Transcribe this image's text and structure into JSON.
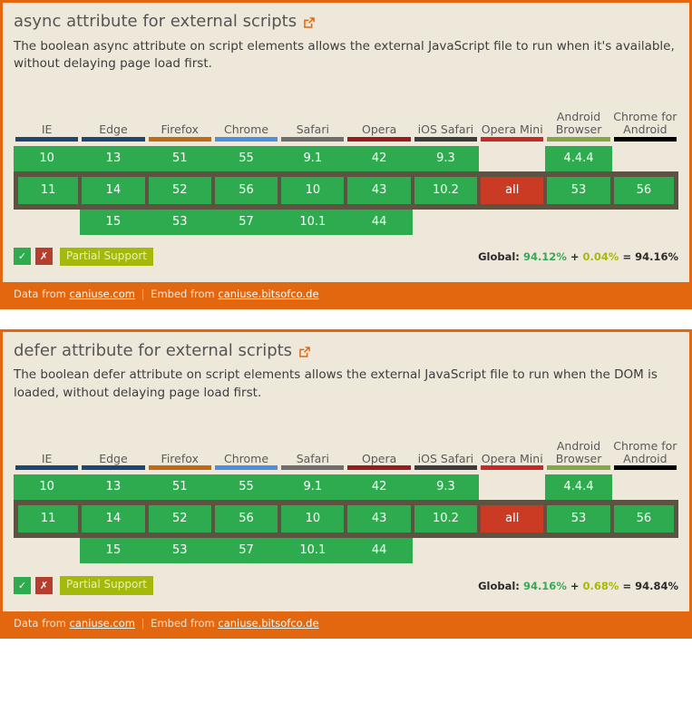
{
  "panels": [
    {
      "title": "async attribute for external scripts",
      "title_link_icon": "external-link-icon",
      "description": "The boolean async attribute on script elements allows the external JavaScript file to run when it's available, without delaying page load first.",
      "browsers": [
        {
          "name": "IE",
          "color": "#1d4674"
        },
        {
          "name": "Edge",
          "color": "#1d4674"
        },
        {
          "name": "Firefox",
          "color": "#bf6a14"
        },
        {
          "name": "Chrome",
          "color": "#4d90e0"
        },
        {
          "name": "Safari",
          "color": "#6e6e6e"
        },
        {
          "name": "Opera",
          "color": "#961d1d"
        },
        {
          "name": "iOS Safari",
          "color": "#3c3c3c"
        },
        {
          "name": "Opera Mini",
          "color": "#c32b2b"
        },
        {
          "name": "Android Browser",
          "color": "#82a845"
        },
        {
          "name": "Chrome for Android",
          "color": "#000000"
        }
      ],
      "rows": [
        {
          "kind": "previous",
          "cells": [
            {
              "label": "10",
              "support": "y"
            },
            {
              "label": "13",
              "support": "y"
            },
            {
              "label": "51",
              "support": "y"
            },
            {
              "label": "55",
              "support": "y"
            },
            {
              "label": "9.1",
              "support": "y"
            },
            {
              "label": "42",
              "support": "y"
            },
            {
              "label": "9.3",
              "support": "y"
            },
            {
              "label": "",
              "support": "empty"
            },
            {
              "label": "4.4.4",
              "support": "y"
            },
            {
              "label": "",
              "support": "empty"
            }
          ]
        },
        {
          "kind": "current",
          "cells": [
            {
              "label": "11",
              "support": "y"
            },
            {
              "label": "14",
              "support": "y"
            },
            {
              "label": "52",
              "support": "y"
            },
            {
              "label": "56",
              "support": "y"
            },
            {
              "label": "10",
              "support": "y"
            },
            {
              "label": "43",
              "support": "y"
            },
            {
              "label": "10.2",
              "support": "y"
            },
            {
              "label": "all",
              "support": "n"
            },
            {
              "label": "53",
              "support": "y"
            },
            {
              "label": "56",
              "support": "y"
            }
          ]
        },
        {
          "kind": "next",
          "cells": [
            {
              "label": "",
              "support": "empty"
            },
            {
              "label": "15",
              "support": "y"
            },
            {
              "label": "53",
              "support": "y"
            },
            {
              "label": "57",
              "support": "y"
            },
            {
              "label": "10.1",
              "support": "y"
            },
            {
              "label": "44",
              "support": "y"
            },
            {
              "label": "",
              "support": "empty"
            },
            {
              "label": "",
              "support": "empty"
            },
            {
              "label": "",
              "support": "empty"
            },
            {
              "label": "",
              "support": "empty"
            }
          ]
        }
      ],
      "legend": {
        "supported_icon": "check-icon",
        "supported_glyph": "✓",
        "unsupported_icon": "cross-icon",
        "unsupported_glyph": "✗",
        "partial_label": "Partial Support"
      },
      "global": {
        "label": "Global:",
        "full": "94.12%",
        "plus": "+",
        "partial": "0.04%",
        "equals": "=",
        "total": "94.16%"
      },
      "footer": {
        "data_from_label": "Data from",
        "data_link": "caniuse.com",
        "separator": "|",
        "embed_from_label": "Embed from",
        "embed_link": "caniuse.bitsofco.de"
      }
    },
    {
      "title": "defer attribute for external scripts",
      "title_link_icon": "external-link-icon",
      "description": "The boolean defer attribute on script elements allows the external JavaScript file to run when the DOM is loaded, without delaying page load first.",
      "browsers": [
        {
          "name": "IE",
          "color": "#1d4674"
        },
        {
          "name": "Edge",
          "color": "#1d4674"
        },
        {
          "name": "Firefox",
          "color": "#bf6a14"
        },
        {
          "name": "Chrome",
          "color": "#4d90e0"
        },
        {
          "name": "Safari",
          "color": "#6e6e6e"
        },
        {
          "name": "Opera",
          "color": "#961d1d"
        },
        {
          "name": "iOS Safari",
          "color": "#3c3c3c"
        },
        {
          "name": "Opera Mini",
          "color": "#c32b2b"
        },
        {
          "name": "Android Browser",
          "color": "#82a845"
        },
        {
          "name": "Chrome for Android",
          "color": "#000000"
        }
      ],
      "rows": [
        {
          "kind": "previous",
          "cells": [
            {
              "label": "10",
              "support": "y"
            },
            {
              "label": "13",
              "support": "y"
            },
            {
              "label": "51",
              "support": "y"
            },
            {
              "label": "55",
              "support": "y"
            },
            {
              "label": "9.1",
              "support": "y"
            },
            {
              "label": "42",
              "support": "y"
            },
            {
              "label": "9.3",
              "support": "y"
            },
            {
              "label": "",
              "support": "empty"
            },
            {
              "label": "4.4.4",
              "support": "y"
            },
            {
              "label": "",
              "support": "empty"
            }
          ]
        },
        {
          "kind": "current",
          "cells": [
            {
              "label": "11",
              "support": "y"
            },
            {
              "label": "14",
              "support": "y"
            },
            {
              "label": "52",
              "support": "y"
            },
            {
              "label": "56",
              "support": "y"
            },
            {
              "label": "10",
              "support": "y"
            },
            {
              "label": "43",
              "support": "y"
            },
            {
              "label": "10.2",
              "support": "y"
            },
            {
              "label": "all",
              "support": "n"
            },
            {
              "label": "53",
              "support": "y"
            },
            {
              "label": "56",
              "support": "y"
            }
          ]
        },
        {
          "kind": "next",
          "cells": [
            {
              "label": "",
              "support": "empty"
            },
            {
              "label": "15",
              "support": "y"
            },
            {
              "label": "53",
              "support": "y"
            },
            {
              "label": "57",
              "support": "y"
            },
            {
              "label": "10.1",
              "support": "y"
            },
            {
              "label": "44",
              "support": "y"
            },
            {
              "label": "",
              "support": "empty"
            },
            {
              "label": "",
              "support": "empty"
            },
            {
              "label": "",
              "support": "empty"
            },
            {
              "label": "",
              "support": "empty"
            }
          ]
        }
      ],
      "legend": {
        "supported_icon": "check-icon",
        "supported_glyph": "✓",
        "unsupported_icon": "cross-icon",
        "unsupported_glyph": "✗",
        "partial_label": "Partial Support"
      },
      "global": {
        "label": "Global:",
        "full": "94.16%",
        "plus": "+",
        "partial": "0.68%",
        "equals": "=",
        "total": "94.84%"
      },
      "footer": {
        "data_from_label": "Data from",
        "data_link": "caniuse.com",
        "separator": "|",
        "embed_from_label": "Embed from",
        "embed_link": "caniuse.bitsofco.de"
      }
    }
  ],
  "theme": {
    "accent": "#e2670e",
    "panel_bg": "#eee8da",
    "supported_bg": "#2fab4f",
    "unsupported_bg": "#cb3b24",
    "partial_bg": "#a5b90c",
    "current_row_border": "#5e5343"
  }
}
